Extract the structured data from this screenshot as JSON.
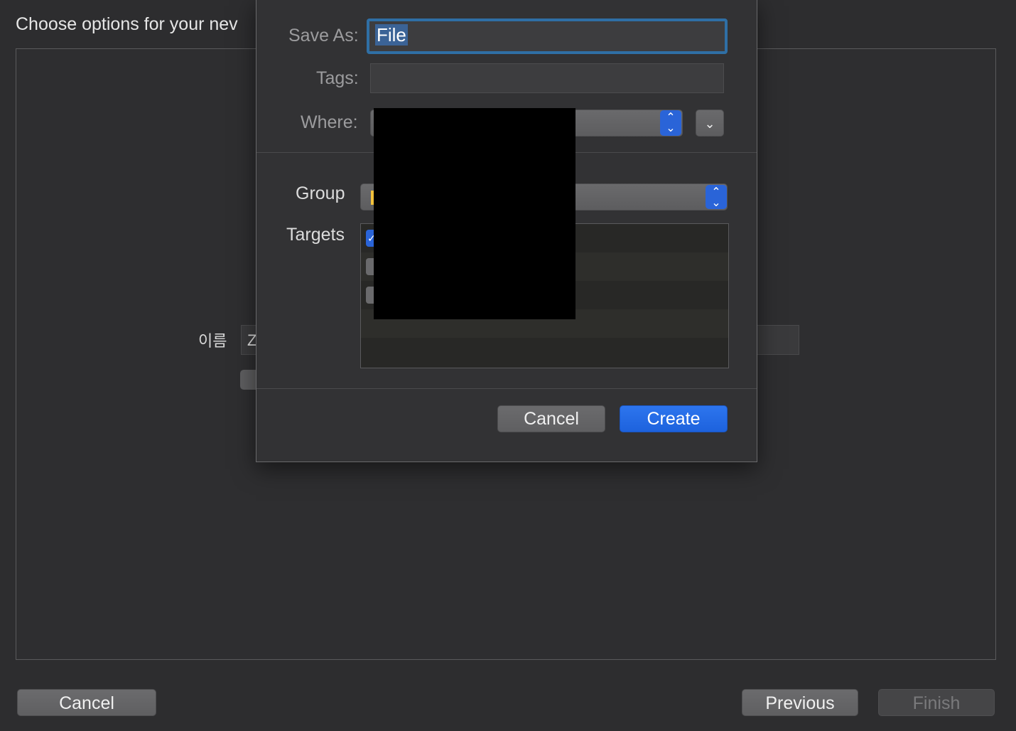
{
  "wizard": {
    "title": "Choose options for your nev",
    "name_label": "이름",
    "name_value": "Z",
    "cancel_label": "Cancel",
    "previous_label": "Previous",
    "finish_label": "Finish"
  },
  "save_dialog": {
    "save_as_label": "Save As:",
    "save_as_value": "File",
    "tags_label": "Tags:",
    "tags_value": "",
    "where_label": "Where:",
    "group_label": "Group",
    "targets_label": "Targets",
    "targets": [
      {
        "checked": true
      },
      {
        "checked": false
      },
      {
        "checked": false
      }
    ],
    "cancel_label": "Cancel",
    "create_label": "Create"
  },
  "icons": {
    "stepper": "up-down-chevron-icon",
    "expand": "chevron-down-icon",
    "folder": "folder-icon",
    "checkbox": "checkmark-icon"
  },
  "colors": {
    "accent": "#2a64d8",
    "focus_ring": "#2f6fa5",
    "folder": "#f3c23c"
  }
}
